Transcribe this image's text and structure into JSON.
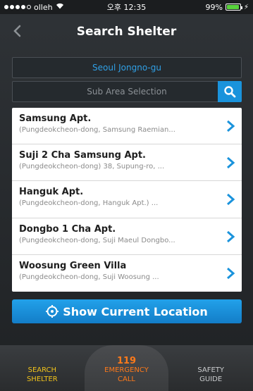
{
  "status_bar": {
    "carrier": "olleh",
    "time": "오후 12:35",
    "battery": "99%"
  },
  "nav": {
    "title": "Search Shelter",
    "back_icon": "chevron-left-icon"
  },
  "area": {
    "main": "Seoul Jongno-gu",
    "sub_placeholder": "Sub Area Selection",
    "search_icon": "search-icon"
  },
  "shelters": [
    {
      "name": "Samsung Apt.",
      "address": "(Pungdeokcheon-dong, Samsung Raemian..."
    },
    {
      "name": "Suji 2 Cha Samsung Apt.",
      "address": "(Pungdeokcheon-dong) 38, Supung-ro, ..."
    },
    {
      "name": "Hanguk Apt.",
      "address": "(Pungdeokcheon-dong, Hanguk Apt.) ..."
    },
    {
      "name": "Dongbo 1 Cha Apt.",
      "address": "(Pungdeokcheon-dong, Suji Maeul Dongbo..."
    },
    {
      "name": "Woosung Green Villa",
      "address": "(Pungdeokcheon-dong, Suji Woosung ..."
    }
  ],
  "location_button": {
    "label": "Show Current Location",
    "icon": "crosshair-icon"
  },
  "tabs": {
    "search": {
      "line1": "SEARCH",
      "line2": "SHELTER"
    },
    "emergency": {
      "number": "119",
      "line1": "EMERGENCY",
      "line2": "CALL"
    },
    "safety": {
      "line1": "SAFETY",
      "line2": "GUIDE"
    }
  },
  "colors": {
    "accent": "#1a93dc",
    "list_chevron": "#1a93dc",
    "tab_search": "#f0c21b",
    "tab_emergency": "#ff7a1a"
  }
}
